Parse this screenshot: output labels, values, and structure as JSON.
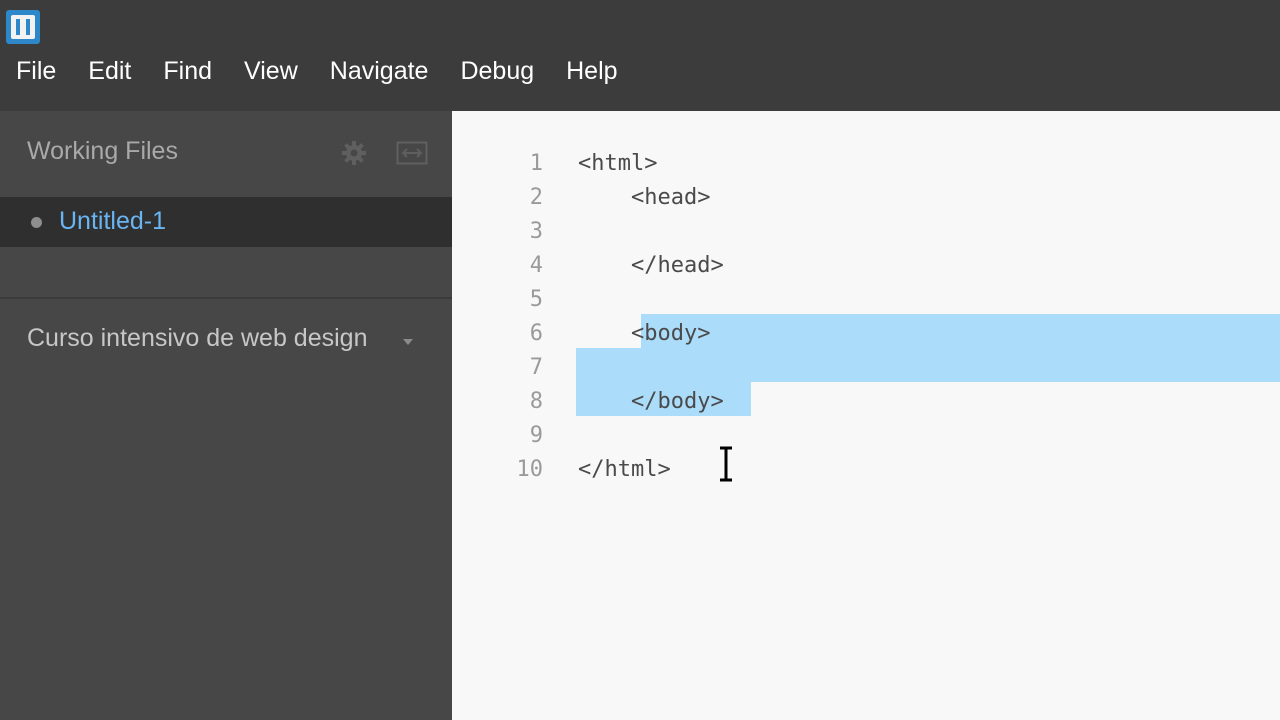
{
  "menu": [
    "File",
    "Edit",
    "Find",
    "View",
    "Navigate",
    "Debug",
    "Help"
  ],
  "sidebar": {
    "working_files_title": "Working Files",
    "settings_icon": "gear-icon",
    "split_icon": "split-view-icon",
    "files": [
      {
        "name": "Untitled-1",
        "status": "unsaved-dot"
      }
    ],
    "project_name": "Curso intensivo de web design"
  },
  "editor": {
    "lines": [
      {
        "num": "1",
        "text": "<html>"
      },
      {
        "num": "2",
        "text": "    <head>"
      },
      {
        "num": "3",
        "text": ""
      },
      {
        "num": "4",
        "text": "    </head>"
      },
      {
        "num": "5",
        "text": ""
      },
      {
        "num": "6",
        "text": "    <body>"
      },
      {
        "num": "7",
        "text": ""
      },
      {
        "num": "8",
        "text": "    </body>"
      },
      {
        "num": "9",
        "text": ""
      },
      {
        "num": "10",
        "text": "</html>"
      }
    ],
    "selected_lines": [
      "6",
      "7",
      "8"
    ]
  },
  "colors": {
    "chrome": "#3c3c3c",
    "sidebar": "#474747",
    "active_file": "#6ab4f2",
    "selection": "#abdcfa",
    "editor_bg": "#f8f8f8"
  }
}
